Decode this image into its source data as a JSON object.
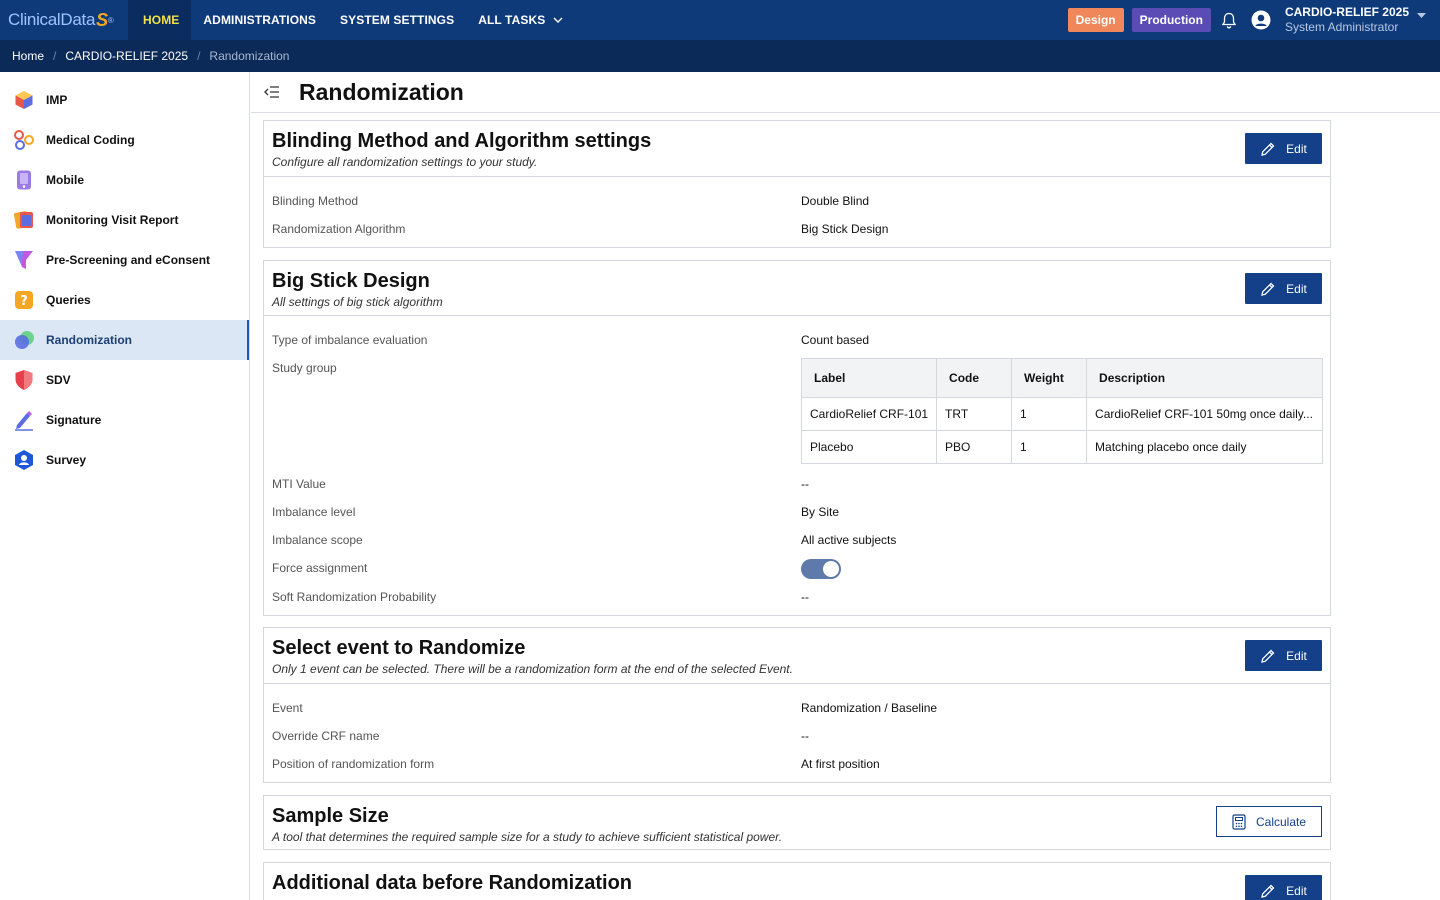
{
  "topbar": {
    "logo_text": "ClinicalData",
    "logo_mark": "S",
    "nav": [
      {
        "label": "HOME",
        "active": true
      },
      {
        "label": "ADMINISTRATIONS",
        "active": false
      },
      {
        "label": "SYSTEM SETTINGS",
        "active": false
      },
      {
        "label": "ALL TASKS",
        "active": false
      }
    ],
    "env_design": "Design",
    "env_production": "Production",
    "user_study": "CARDIO-RELIEF 2025",
    "user_role": "System Administrator"
  },
  "breadcrumb": {
    "home": "Home",
    "study": "CARDIO-RELIEF 2025",
    "current": "Randomization"
  },
  "sidebar": {
    "items": [
      {
        "label": "IMP",
        "icon": "cube-icon"
      },
      {
        "label": "Medical Coding",
        "icon": "coding-icon"
      },
      {
        "label": "Mobile",
        "icon": "mobile-icon"
      },
      {
        "label": "Monitoring Visit Report",
        "icon": "report-icon"
      },
      {
        "label": "Pre-Screening and eConsent",
        "icon": "funnel-icon"
      },
      {
        "label": "Queries",
        "icon": "question-icon"
      },
      {
        "label": "Randomization",
        "icon": "randomization-icon",
        "active": true
      },
      {
        "label": "SDV",
        "icon": "shield-icon"
      },
      {
        "label": "Signature",
        "icon": "pen-icon"
      },
      {
        "label": "Survey",
        "icon": "survey-icon"
      }
    ]
  },
  "page": {
    "title": "Randomization"
  },
  "blinding": {
    "title": "Blinding Method and Algorithm settings",
    "subtitle": "Configure all randomization settings to your study.",
    "edit_label": "Edit",
    "fields": [
      {
        "label": "Blinding Method",
        "value": "Double Blind"
      },
      {
        "label": "Randomization Algorithm",
        "value": "Big Stick Design"
      }
    ]
  },
  "bigstick": {
    "title": "Big Stick Design",
    "subtitle": "All settings of big stick algorithm",
    "edit_label": "Edit",
    "imbalance_type_label": "Type of imbalance evaluation",
    "imbalance_type_value": "Count based",
    "study_group_label": "Study group",
    "table": {
      "headers": [
        "Label",
        "Code",
        "Weight",
        "Description"
      ],
      "rows": [
        [
          "CardioRelief CRF-101",
          "TRT",
          "1",
          "CardioRelief CRF-101 50mg once daily..."
        ],
        [
          "Placebo",
          "PBO",
          "1",
          "Matching placebo once daily"
        ]
      ]
    },
    "mti_label": "MTI Value",
    "mti_value": "--",
    "level_label": "Imbalance level",
    "level_value": "By Site",
    "scope_label": "Imbalance scope",
    "scope_value": "All active subjects",
    "force_label": "Force assignment",
    "force_value": true,
    "soft_label": "Soft Randomization Probability",
    "soft_value": "--"
  },
  "event": {
    "title": "Select event to Randomize",
    "subtitle": "Only 1 event can be selected. There will be a randomization form at the end of the selected Event.",
    "edit_label": "Edit",
    "fields": [
      {
        "label": "Event",
        "value": "Randomization / Baseline"
      },
      {
        "label": "Override CRF name",
        "value": "--"
      },
      {
        "label": "Position of randomization form",
        "value": "At first position"
      }
    ]
  },
  "sample": {
    "title": "Sample Size",
    "subtitle": "A tool that determines the required sample size for a study to achieve sufficient statistical power.",
    "calc_label": "Calculate"
  },
  "additional": {
    "title": "Additional data before Randomization",
    "edit_label": "Edit"
  },
  "colors": {
    "topbar": "#0e3a7a",
    "breadcrumb": "#0b2a57",
    "primary_button": "#134088",
    "design_badge": "#f0875a",
    "production_badge": "#5b4bb5",
    "toggle_on": "#5d7aab",
    "active_nav_text": "#f2e14a"
  }
}
